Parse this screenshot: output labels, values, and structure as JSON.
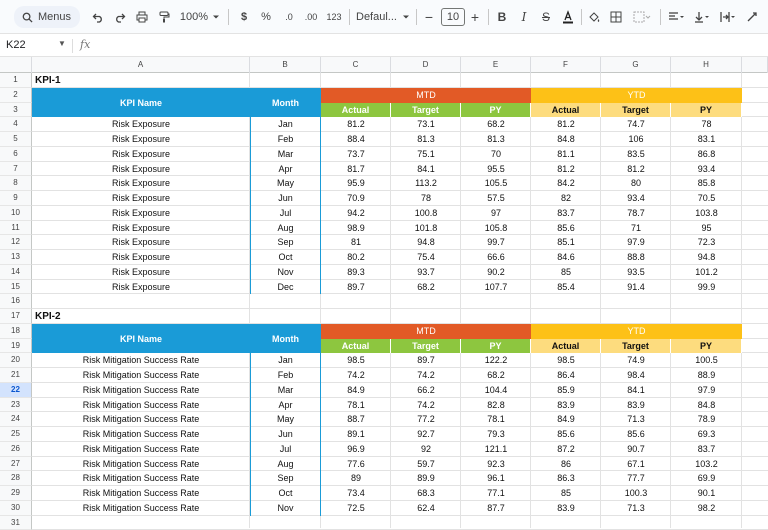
{
  "toolbar": {
    "menus_label": "Menus",
    "zoom": "100%",
    "currency": "$",
    "percent": "%",
    "dec_decrease": ".0",
    "dec_increase": ".00",
    "number_format": "123",
    "font": "Defaul...",
    "font_size": "10",
    "minus": "−",
    "plus": "+"
  },
  "formula_bar": {
    "cell_ref": "K22",
    "fx": "fx"
  },
  "columns": [
    "A",
    "B",
    "C",
    "D",
    "E",
    "F",
    "G",
    "H"
  ],
  "selected_row": "22",
  "colors": {
    "header_blue": "#1a9bd7",
    "mtd_orange": "#e25a26",
    "mtd_sub_green": "#8dc63f",
    "ytd_yellow": "#fdc117",
    "ytd_sub_yellow": "#fddc7e",
    "kpi_text": "#ffffff"
  },
  "kpi1": {
    "title": "KPI-1",
    "kpi_name_header": "KPI Name",
    "month_header": "Month",
    "mtd": "MTD",
    "ytd": "YTD",
    "sub": [
      "Actual",
      "Target",
      "PY",
      "Actual",
      "Target",
      "PY"
    ],
    "rows": [
      {
        "name": "Risk Exposure",
        "month": "Jan",
        "v": [
          "81.2",
          "73.1",
          "68.2",
          "81.2",
          "74.7",
          "78"
        ]
      },
      {
        "name": "Risk Exposure",
        "month": "Feb",
        "v": [
          "88.4",
          "81.3",
          "81.3",
          "84.8",
          "106",
          "83.1"
        ]
      },
      {
        "name": "Risk Exposure",
        "month": "Mar",
        "v": [
          "73.7",
          "75.1",
          "70",
          "81.1",
          "83.5",
          "86.8"
        ]
      },
      {
        "name": "Risk Exposure",
        "month": "Apr",
        "v": [
          "81.7",
          "84.1",
          "95.5",
          "81.2",
          "81.2",
          "93.4"
        ]
      },
      {
        "name": "Risk Exposure",
        "month": "May",
        "v": [
          "95.9",
          "113.2",
          "105.5",
          "84.2",
          "80",
          "85.8"
        ]
      },
      {
        "name": "Risk Exposure",
        "month": "Jun",
        "v": [
          "70.9",
          "78",
          "57.5",
          "82",
          "93.4",
          "70.5"
        ]
      },
      {
        "name": "Risk Exposure",
        "month": "Jul",
        "v": [
          "94.2",
          "100.8",
          "97",
          "83.7",
          "78.7",
          "103.8"
        ]
      },
      {
        "name": "Risk Exposure",
        "month": "Aug",
        "v": [
          "98.9",
          "101.8",
          "105.8",
          "85.6",
          "71",
          "95"
        ]
      },
      {
        "name": "Risk Exposure",
        "month": "Sep",
        "v": [
          "81",
          "94.8",
          "99.7",
          "85.1",
          "97.9",
          "72.3"
        ]
      },
      {
        "name": "Risk Exposure",
        "month": "Oct",
        "v": [
          "80.2",
          "75.4",
          "66.6",
          "84.6",
          "88.8",
          "94.8"
        ]
      },
      {
        "name": "Risk Exposure",
        "month": "Nov",
        "v": [
          "89.3",
          "93.7",
          "90.2",
          "85",
          "93.5",
          "101.2"
        ]
      },
      {
        "name": "Risk Exposure",
        "month": "Dec",
        "v": [
          "89.7",
          "68.2",
          "107.7",
          "85.4",
          "91.4",
          "99.9"
        ]
      }
    ]
  },
  "kpi2": {
    "title": "KPI-2",
    "kpi_name_header": "KPI Name",
    "month_header": "Month",
    "mtd": "MTD",
    "ytd": "YTD",
    "sub": [
      "Actual",
      "Target",
      "PY",
      "Actual",
      "Target",
      "PY"
    ],
    "rows": [
      {
        "name": "Risk Mitigation Success Rate",
        "month": "Jan",
        "v": [
          "98.5",
          "89.7",
          "122.2",
          "98.5",
          "74.9",
          "100.5"
        ]
      },
      {
        "name": "Risk Mitigation Success Rate",
        "month": "Feb",
        "v": [
          "74.2",
          "74.2",
          "68.2",
          "86.4",
          "98.4",
          "88.9"
        ]
      },
      {
        "name": "Risk Mitigation Success Rate",
        "month": "Mar",
        "v": [
          "84.9",
          "66.2",
          "104.4",
          "85.9",
          "84.1",
          "97.9"
        ]
      },
      {
        "name": "Risk Mitigation Success Rate",
        "month": "Apr",
        "v": [
          "78.1",
          "74.2",
          "82.8",
          "83.9",
          "83.9",
          "84.8"
        ]
      },
      {
        "name": "Risk Mitigation Success Rate",
        "month": "May",
        "v": [
          "88.7",
          "77.2",
          "78.1",
          "84.9",
          "71.3",
          "78.9"
        ]
      },
      {
        "name": "Risk Mitigation Success Rate",
        "month": "Jun",
        "v": [
          "89.1",
          "92.7",
          "79.3",
          "85.6",
          "85.6",
          "69.3"
        ]
      },
      {
        "name": "Risk Mitigation Success Rate",
        "month": "Jul",
        "v": [
          "96.9",
          "92",
          "121.1",
          "87.2",
          "90.7",
          "83.7"
        ]
      },
      {
        "name": "Risk Mitigation Success Rate",
        "month": "Aug",
        "v": [
          "77.6",
          "59.7",
          "92.3",
          "86",
          "67.1",
          "103.2"
        ]
      },
      {
        "name": "Risk Mitigation Success Rate",
        "month": "Sep",
        "v": [
          "89",
          "89.9",
          "96.1",
          "86.3",
          "77.7",
          "69.9"
        ]
      },
      {
        "name": "Risk Mitigation Success Rate",
        "month": "Oct",
        "v": [
          "73.4",
          "68.3",
          "77.1",
          "85",
          "100.3",
          "90.1"
        ]
      },
      {
        "name": "Risk Mitigation Success Rate",
        "month": "Nov",
        "v": [
          "72.5",
          "62.4",
          "87.7",
          "83.9",
          "71.3",
          "98.2"
        ]
      }
    ]
  }
}
